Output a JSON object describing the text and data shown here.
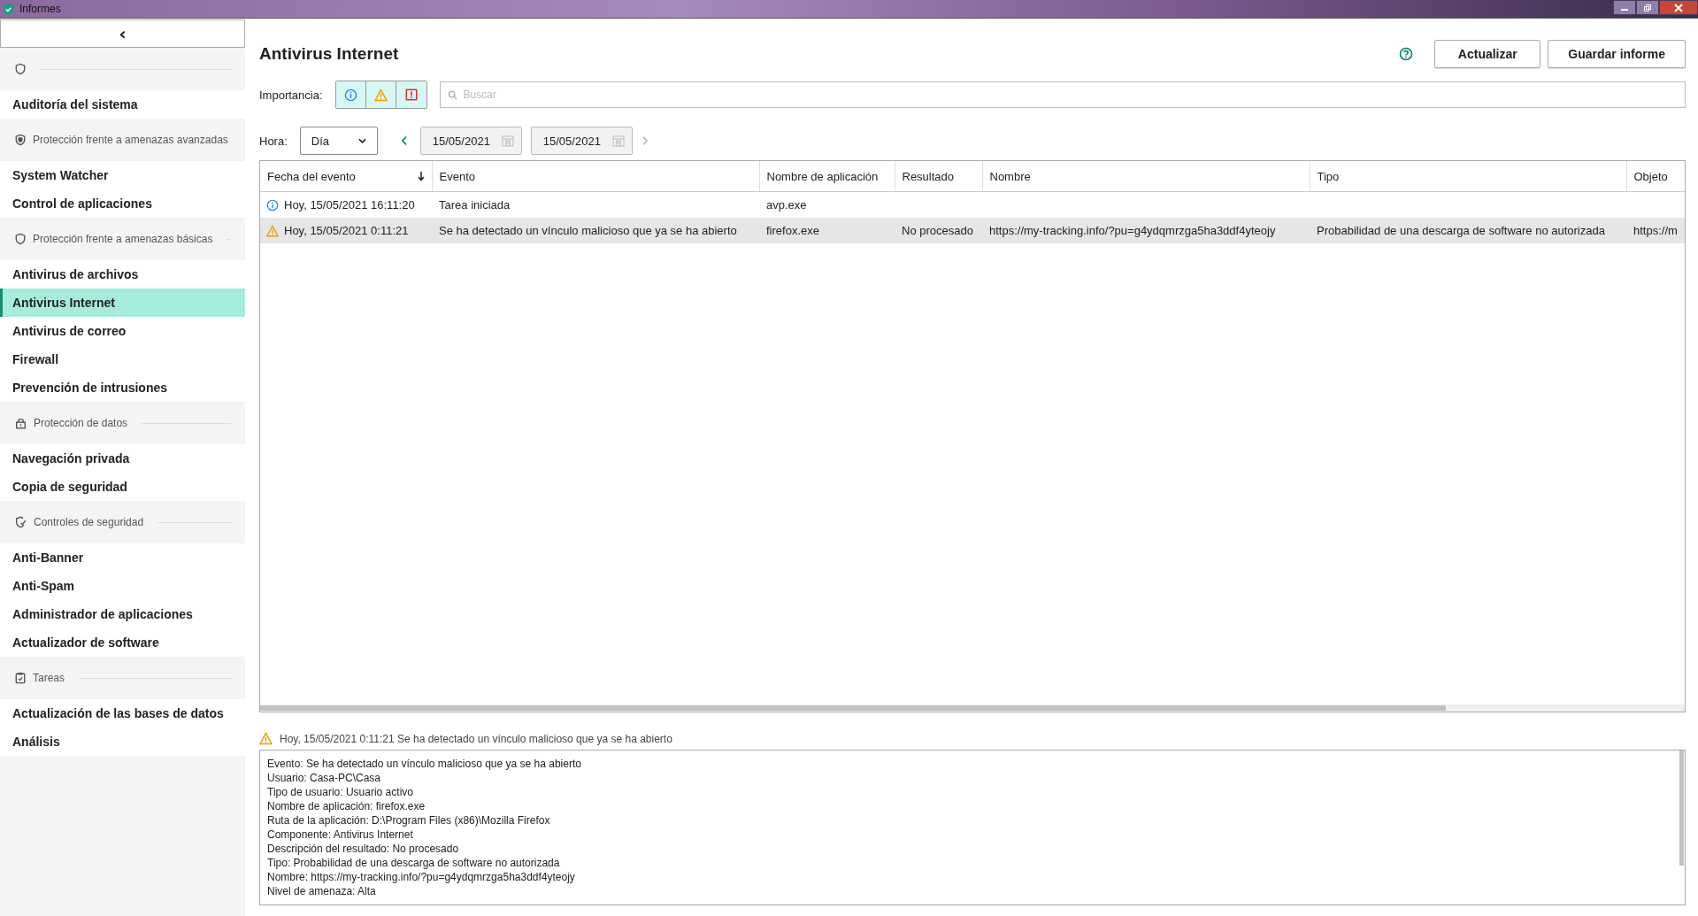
{
  "window": {
    "title": "Informes"
  },
  "sidebar": {
    "collapse_button": "‹",
    "groups": [
      {
        "kind": "shield",
        "items": [
          {
            "label": "Auditoría del sistema",
            "selected": false
          }
        ]
      },
      {
        "kind": "shield-advanced",
        "label": "Protección frente a amenazas avanzadas",
        "items": [
          {
            "label": "System Watcher",
            "selected": false
          },
          {
            "label": "Control de aplicaciones",
            "selected": false
          }
        ]
      },
      {
        "kind": "shield",
        "label": "Protección frente a amenazas básicas",
        "items": [
          {
            "label": "Antivirus de archivos",
            "selected": false
          },
          {
            "label": "Antivirus Internet",
            "selected": true
          },
          {
            "label": "Antivirus de correo",
            "selected": false
          },
          {
            "label": "Firewall",
            "selected": false
          },
          {
            "label": "Prevención de intrusiones",
            "selected": false
          }
        ]
      },
      {
        "kind": "lock",
        "label": "Protección de datos",
        "items": [
          {
            "label": "Navegación privada",
            "selected": false
          },
          {
            "label": "Copia de seguridad",
            "selected": false
          }
        ]
      },
      {
        "kind": "shield-check",
        "label": "Controles de seguridad",
        "items": [
          {
            "label": "Anti-Banner",
            "selected": false
          },
          {
            "label": "Anti-Spam",
            "selected": false
          },
          {
            "label": "Administrador de aplicaciones",
            "selected": false
          },
          {
            "label": "Actualizador de software",
            "selected": false
          }
        ]
      },
      {
        "kind": "clipboard",
        "label": "Tareas",
        "items": [
          {
            "label": "Actualización de las bases de datos",
            "selected": false
          },
          {
            "label": "Análisis",
            "selected": false
          }
        ]
      }
    ]
  },
  "header": {
    "title": "Antivirus Internet",
    "buttons": [
      "Actualizar",
      "Guardar informe"
    ]
  },
  "filters": {
    "importance_label": "Importancia:",
    "importance": [
      {
        "kind": "info",
        "on": true
      },
      {
        "kind": "warning",
        "on": true
      },
      {
        "kind": "critical",
        "on": true
      }
    ],
    "search": {
      "placeholder": "Buscar"
    },
    "time_label": "Hora:",
    "period": "Día",
    "date_from": "15/05/2021",
    "date_to": "15/05/2021",
    "prev_disabled": false,
    "next_disabled": true
  },
  "table": {
    "columns": [
      {
        "label": "Fecha del evento",
        "sorted": true
      },
      {
        "label": "Evento",
        "sorted": false
      },
      {
        "label": "Nombre de aplicación",
        "sorted": false
      },
      {
        "label": "Resultado",
        "sorted": false
      },
      {
        "label": "Nombre",
        "sorted": false
      },
      {
        "label": "Tipo",
        "sorted": false
      },
      {
        "label": "Objeto",
        "sorted": false
      }
    ],
    "rows": [
      {
        "kind": "info",
        "selected": false,
        "cells": [
          "Hoy, 15/05/2021 16:11:20",
          "Tarea iniciada",
          "avp.exe",
          "",
          "",
          "",
          ""
        ]
      },
      {
        "kind": "warning",
        "selected": true,
        "cells": [
          "Hoy, 15/05/2021 0:11:21",
          "Se ha detectado un vínculo malicioso que ya se ha abierto",
          "firefox.exe",
          "No procesado",
          "https://my-tracking.info/?pu=g4ydqmrzga5ha3ddf4yteojy",
          "Probabilidad de una descarga de software no autorizada",
          "https://m"
        ]
      }
    ]
  },
  "details": {
    "kind": "warning",
    "heading": "Hoy, 15/05/2021 0:11:21 Se ha detectado un vínculo malicioso que ya se ha abierto",
    "lines": [
      "Evento: Se ha detectado un vínculo malicioso que ya se ha abierto",
      "Usuario: Casa-PC\\Casa",
      "Tipo de usuario: Usuario activo",
      "Nombre de aplicación: firefox.exe",
      "Ruta de la aplicación: D:\\Program Files (x86)\\Mozilla Firefox",
      "Componente: Antivirus Internet",
      "Descripción del resultado: No procesado",
      "Tipo: Probabilidad de una descarga de software no autorizada",
      "Nombre: https://my-tracking.info/?pu=g4ydqmrzga5ha3ddf4yteojy",
      "Nivel de amenaza: Alta"
    ]
  }
}
